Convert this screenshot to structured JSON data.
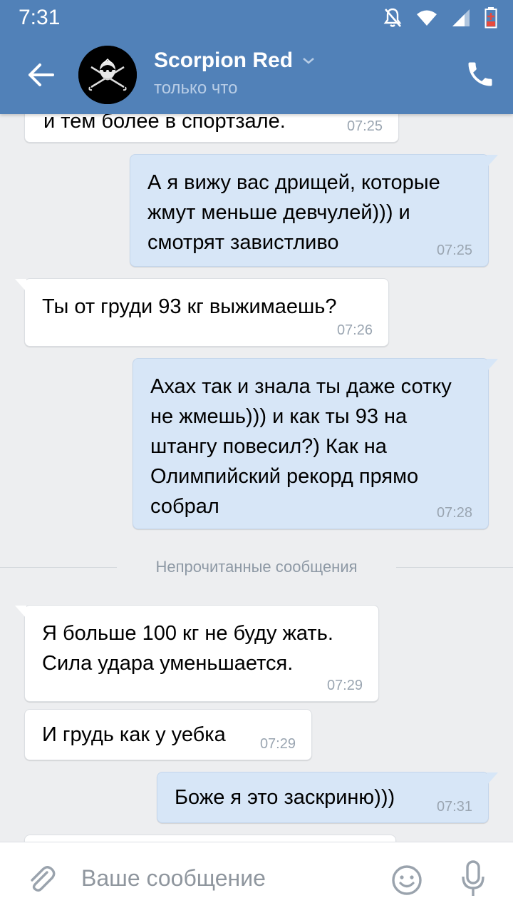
{
  "status_bar": {
    "time": "7:31"
  },
  "header": {
    "contact_name": "Scorpion Red",
    "contact_status": "только что"
  },
  "messages": [
    {
      "dir": "in",
      "text": "и тем более в спортзале.",
      "time": "07:25"
    },
    {
      "dir": "out",
      "text": "А я вижу вас дрищей, которые жмут меньше девчулей))) и смотрят завистливо",
      "time": "07:25"
    },
    {
      "dir": "in",
      "text": "Ты от груди 93 кг выжимаешь?",
      "time": "07:26"
    },
    {
      "dir": "out",
      "text": "Ахах так и знала ты даже сотку не жмешь))) и как ты 93 на штангу повесил?) Как на Олимпийский рекорд прямо собрал",
      "time": "07:28"
    },
    {
      "dir": "in",
      "text": "Я больше 100 кг не буду жать. Сила удара уменьшается.",
      "time": "07:29"
    },
    {
      "dir": "in",
      "text": "И грудь как у уебка",
      "time": "07:29"
    },
    {
      "dir": "out",
      "text": "Боже я это заскриню)))",
      "time": "07:31"
    }
  ],
  "divider": {
    "label": "Непрочитанные сообщения"
  },
  "input": {
    "placeholder": "Ваше сообщение"
  },
  "colors": {
    "header": "#5181b8",
    "incoming": "#ffffff",
    "outgoing": "#d7e6f7",
    "background": "#edeef0"
  }
}
